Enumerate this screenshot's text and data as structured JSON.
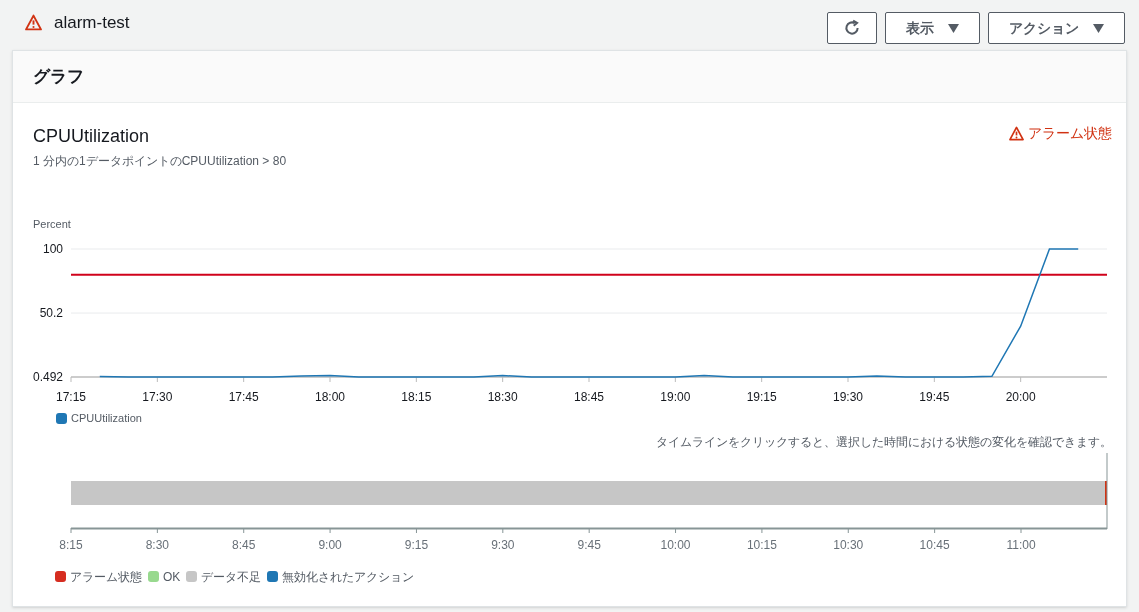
{
  "header": {
    "title": "alarm-test",
    "buttons": [
      {
        "kind": "refresh"
      },
      {
        "kind": "dropdown",
        "label": "表示"
      },
      {
        "kind": "dropdown",
        "label": "アクション"
      }
    ]
  },
  "panel": {
    "title": "グラフ",
    "metric": {
      "title": "CPUUtilization",
      "subtitle": "1 分内の1データポイントのCPUUtilization > 80",
      "state_label": "アラーム状態"
    },
    "chart_data": {
      "type": "line",
      "ylabel": "Percent",
      "x": [
        1040,
        1045,
        1050,
        1055,
        1060,
        1065,
        1070,
        1075,
        1080,
        1085,
        1090,
        1095,
        1100,
        1105,
        1110,
        1115,
        1120,
        1125,
        1130,
        1135,
        1140,
        1145,
        1150,
        1155,
        1160,
        1165,
        1170,
        1175,
        1180,
        1185,
        1190,
        1195,
        1200,
        1205,
        1210
      ],
      "series": [
        {
          "name": "CPUUtilization",
          "color": "#1f77b4",
          "values": [
            0.9,
            0.5,
            0.5,
            0.5,
            0.5,
            0.5,
            0.5,
            1.2,
            1.6,
            0.5,
            0.5,
            0.5,
            0.5,
            0.5,
            1.6,
            0.5,
            0.5,
            0.5,
            0.5,
            0.5,
            0.5,
            1.6,
            0.5,
            0.5,
            0.5,
            0.5,
            0.5,
            1.2,
            0.5,
            0.5,
            0.5,
            1.0,
            40,
            100,
            100
          ]
        }
      ],
      "xlim": [
        1035,
        1215
      ],
      "ylim": [
        0.492,
        100
      ],
      "xticks": [
        {
          "value": 1035,
          "label": "17:15"
        },
        {
          "value": 1050,
          "label": "17:30"
        },
        {
          "value": 1065,
          "label": "17:45"
        },
        {
          "value": 1080,
          "label": "18:00"
        },
        {
          "value": 1095,
          "label": "18:15"
        },
        {
          "value": 1110,
          "label": "18:30"
        },
        {
          "value": 1125,
          "label": "18:45"
        },
        {
          "value": 1140,
          "label": "19:00"
        },
        {
          "value": 1155,
          "label": "19:15"
        },
        {
          "value": 1170,
          "label": "19:30"
        },
        {
          "value": 1185,
          "label": "19:45"
        },
        {
          "value": 1200,
          "label": "20:00"
        }
      ],
      "yticks": [
        {
          "value": 0.492,
          "label": "0.492"
        },
        {
          "value": 50.2,
          "label": "50.2"
        },
        {
          "value": 100,
          "label": "100"
        }
      ],
      "ref_lines": [
        {
          "axis": "y",
          "value": 80,
          "color": "#d0021b"
        }
      ]
    },
    "timeline": {
      "hint": "タイムラインをクリックすると、選択した時間における状態の変化を確認できます。",
      "segments": [
        {
          "kind": "insufficient"
        },
        {
          "kind": "alarm"
        }
      ],
      "ticks": [
        "8:15",
        "8:30",
        "8:45",
        "9:00",
        "9:15",
        "9:30",
        "9:45",
        "10:00",
        "10:15",
        "10:30",
        "10:45",
        "11:00"
      ],
      "legend": [
        {
          "label": "アラーム状態",
          "color": "#d62d20"
        },
        {
          "label": "OK",
          "color": "#98d98e"
        },
        {
          "label": "データ不足",
          "color": "#c6c6c6"
        },
        {
          "label": "無効化されたアクション",
          "color": "#1f77b4"
        }
      ]
    }
  }
}
